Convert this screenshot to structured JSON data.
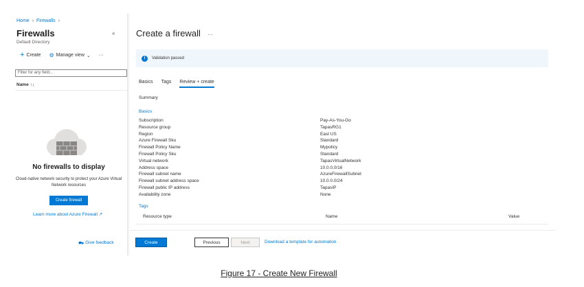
{
  "breadcrumb": {
    "items": [
      "Home",
      "Firewalls"
    ]
  },
  "left_pane": {
    "title": "Firewalls",
    "subtitle": "Default Directory",
    "toolbar": {
      "create_label": "Create",
      "manage_view_label": "Manage view",
      "more_label": "···"
    },
    "filter_placeholder": "Filter for any field...",
    "column_header": "Name ↑↓",
    "empty_title": "No firewalls to display",
    "empty_description": "Cloud-native network security to protect your Azure Virtual Network resources",
    "create_button": "Create firewall",
    "learn_more": "Learn more about Azure Firewall ↗",
    "feedback": "Give feedback"
  },
  "blade": {
    "title": "Create a firewall",
    "more_label": "···",
    "validation": "Validation passed",
    "tabs": [
      {
        "label": "Basics",
        "active": false
      },
      {
        "label": "Tags",
        "active": false
      },
      {
        "label": "Review + create",
        "active": true
      }
    ],
    "summary_label": "Summary",
    "basics_label": "Basics",
    "fields": [
      {
        "label": "Subscription",
        "value": "Pay-As-You-Go"
      },
      {
        "label": "Resource group",
        "value": "TapasRG1"
      },
      {
        "label": "Region",
        "value": "East US"
      },
      {
        "label": "Azure Firewall Sku",
        "value": "Standard"
      },
      {
        "label": "Firewall Policy Name",
        "value": "Mypolicy"
      },
      {
        "label": "Firewall Policy Sku",
        "value": "Standard"
      },
      {
        "label": "Virtual network",
        "value": "TapasVirtualNetwork"
      },
      {
        "label": "Address space",
        "value": "10.0.0.0/16"
      },
      {
        "label": "Firewall subnet name",
        "value": "AzureFirewallSubnet"
      },
      {
        "label": "Firewall subnet address space",
        "value": "10.0.0.0/24"
      },
      {
        "label": "Firewall public IP address",
        "value": "TapasIP"
      },
      {
        "label": "Availability zone",
        "value": "None"
      }
    ],
    "tags_label": "Tags",
    "tags_table_headers": [
      "Resource type",
      "Name",
      "Value"
    ],
    "buttons": {
      "create": "Create",
      "previous": "Previous",
      "next": "Next"
    },
    "download_link": "Download a template for automation"
  },
  "caption": "Figure 17 - Create New Firewall",
  "colors": {
    "accent": "#0078d4",
    "info_bg": "#eff6fc"
  }
}
